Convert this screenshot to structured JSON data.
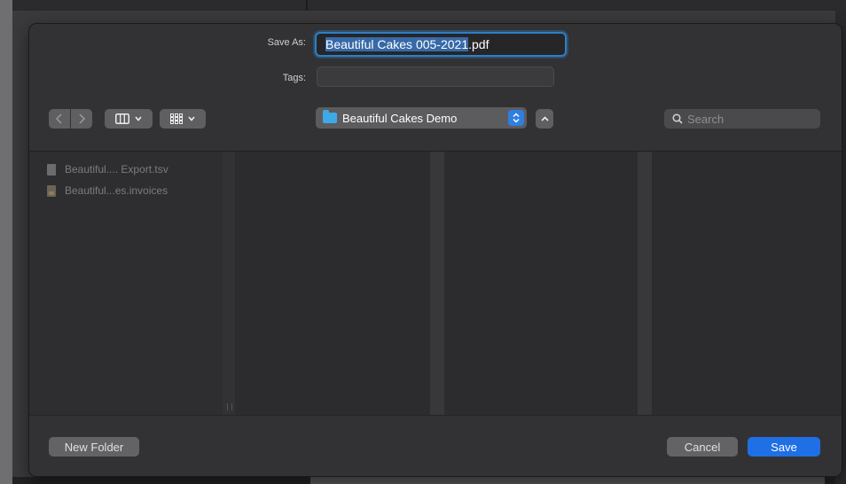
{
  "dialog": {
    "save_as_label": "Save As:",
    "filename_selected": "Beautiful Cakes 005-2021",
    "filename_ext": ".pdf",
    "tags_label": "Tags:",
    "tags_value": ""
  },
  "toolbar": {
    "location": "Beautiful Cakes Demo",
    "search_placeholder": "Search"
  },
  "files": [
    {
      "name": "Beautiful.... Export.tsv",
      "icon": "document-icon"
    },
    {
      "name": "Beautiful...es.invoices",
      "icon": "invoice-document-icon"
    }
  ],
  "footer": {
    "new_folder": "New Folder",
    "cancel": "Cancel",
    "save": "Save"
  },
  "colors": {
    "accent": "#1f6fe5",
    "selection": "#3769a7",
    "folder": "#3fa9e8"
  }
}
